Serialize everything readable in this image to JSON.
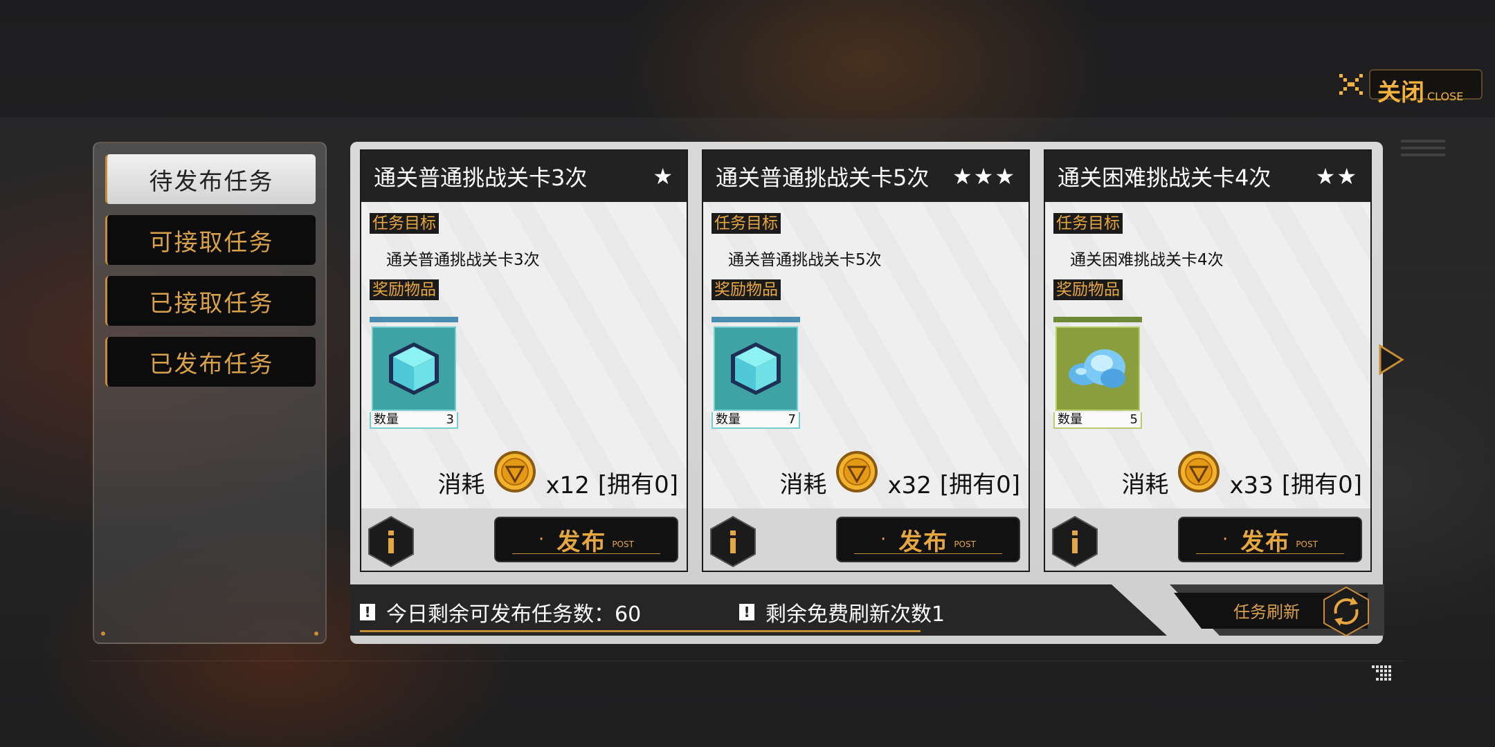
{
  "close": {
    "label_cn": "关闭",
    "label_en": "CLOSE"
  },
  "sidebar": {
    "items": [
      {
        "label": "待发布任务",
        "active": true
      },
      {
        "label": "可接取任务",
        "active": false
      },
      {
        "label": "已接取任务",
        "active": false
      },
      {
        "label": "已发布任务",
        "active": false
      }
    ]
  },
  "cards": [
    {
      "title": "通关普通挑战关卡3次",
      "stars": "★",
      "goal_tag": "任务目标",
      "goal": "通关普通挑战关卡3次",
      "reward_tag": "奖励物品",
      "reward": {
        "icon": "cube-icon",
        "qty_label": "数量",
        "qty": "3",
        "color": "#3fa3a3"
      },
      "cost_label": "消耗",
      "cost": "x12",
      "owned": "[拥有0]",
      "post_cn": "发布",
      "post_en": "POST"
    },
    {
      "title": "通关普通挑战关卡5次",
      "stars": "★★★",
      "goal_tag": "任务目标",
      "goal": "通关普通挑战关卡5次",
      "reward_tag": "奖励物品",
      "reward": {
        "icon": "cube-icon",
        "qty_label": "数量",
        "qty": "7",
        "color": "#3fa3a3"
      },
      "cost_label": "消耗",
      "cost": "x32",
      "owned": "[拥有0]",
      "post_cn": "发布",
      "post_en": "POST"
    },
    {
      "title": "通关困难挑战关卡4次",
      "stars": "★★",
      "goal_tag": "任务目标",
      "goal": "通关困难挑战关卡4次",
      "reward_tag": "奖励物品",
      "reward": {
        "icon": "crystal-icon",
        "qty_label": "数量",
        "qty": "5",
        "color": "#8a9e3e"
      },
      "cost_label": "消耗",
      "cost": "x33",
      "owned": "[拥有0]",
      "post_cn": "发布",
      "post_en": "POST"
    }
  ],
  "footer": {
    "daily_remaining": "今日剩余可发布任务数：60",
    "free_refresh": "剩余免费刷新次数1",
    "refresh_label": "任务刷新"
  },
  "colors": {
    "accent": "#e7a73f",
    "dark": "#1b1b1b",
    "panel": "#d9d9d9"
  }
}
